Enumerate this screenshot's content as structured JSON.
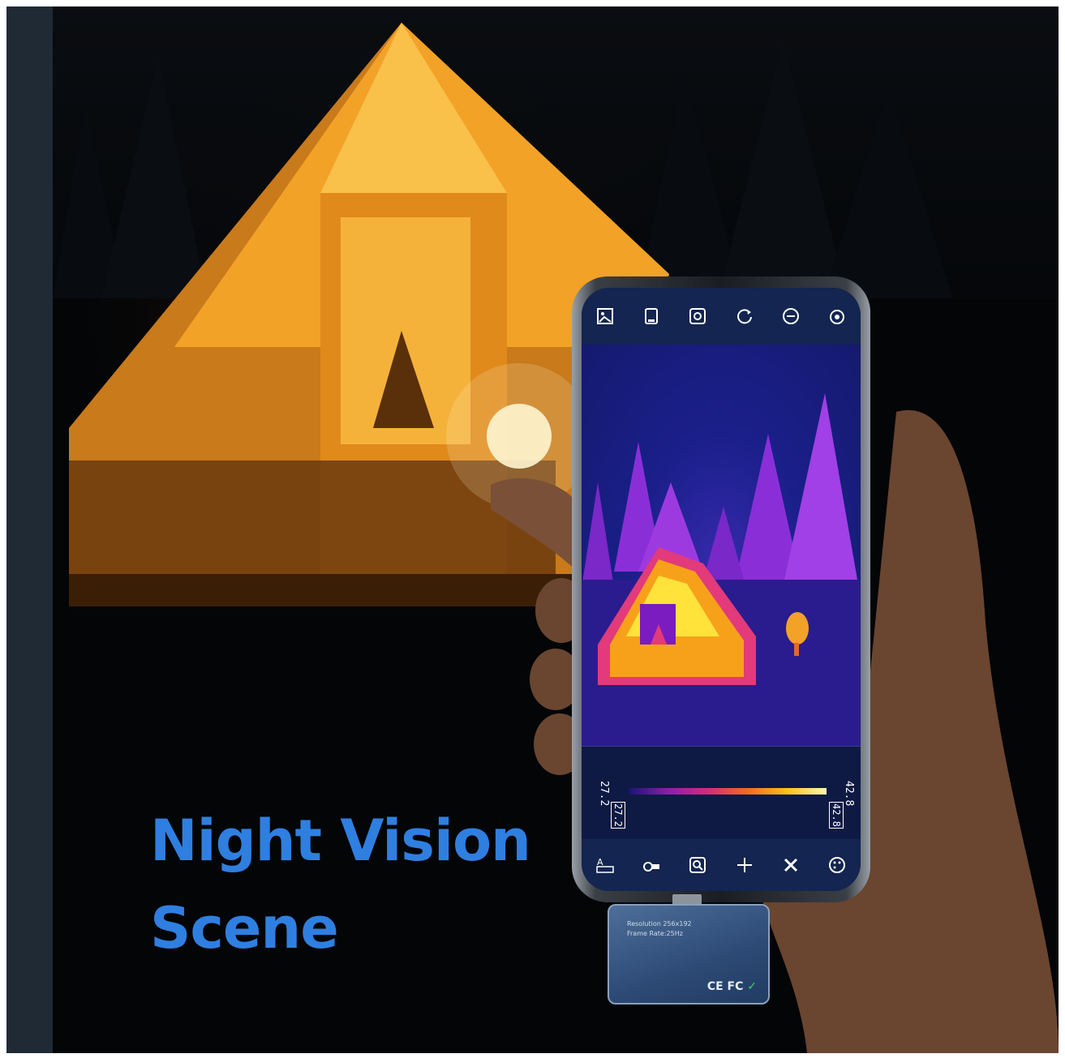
{
  "headline": {
    "line1": "Night Vision",
    "line2": "Scene"
  },
  "phone_app": {
    "toolbar_icons": [
      "image-gallery-icon",
      "sd-card-icon",
      "camera-settings-icon",
      "rotate-icon",
      "zoom-out-icon",
      "camera-switch-icon"
    ],
    "bottom_icons": [
      "measure-ruler-icon",
      "video-record-icon",
      "search-icon",
      "crosshair-add-icon",
      "tools-icon",
      "palette-icon"
    ],
    "scale": {
      "min_top": "27.2",
      "min_box": "27.2",
      "max_top": "42.8",
      "max_box": "42.8"
    }
  },
  "device": {
    "resolution": "Resolution 256x192",
    "frame_rate": "Frame Rate:25Hz",
    "certification": "CE FC",
    "check": "✓"
  },
  "colors": {
    "headline": "#2f7fe0",
    "tent_glow": "#f2a227",
    "thermal_bg": "#1a1f8a"
  }
}
